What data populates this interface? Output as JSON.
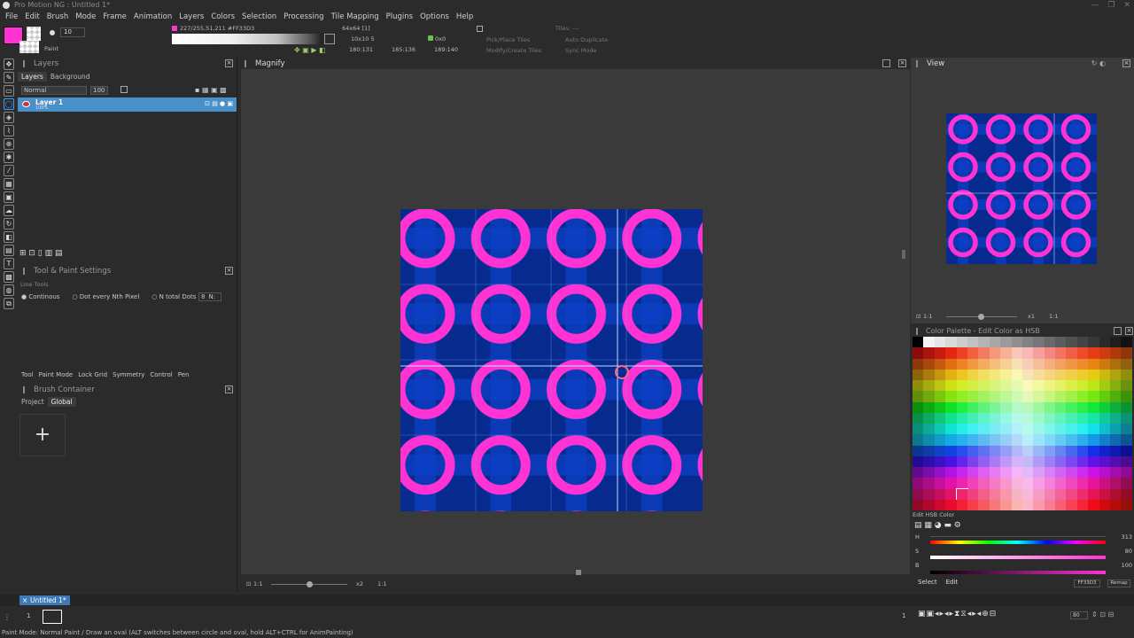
{
  "window": {
    "title": "Pro Motion NG : Untitled 1*",
    "controls": [
      "—",
      "❐",
      "✕"
    ]
  },
  "menu": [
    "File",
    "Edit",
    "Brush",
    "Mode",
    "Frame",
    "Animation",
    "Layers",
    "Colors",
    "Selection",
    "Processing",
    "Tile Mapping",
    "Plugins",
    "Options",
    "Help"
  ],
  "toolbar": {
    "brush_size": "10",
    "mode_label": "Paint",
    "color_readout": "227/255,51,211 #FF33D3",
    "image_size": "64x64 [1]",
    "grid_size": "10x10 5",
    "offset": "0x0",
    "coord_a": "180:131",
    "coord_b": "185:136",
    "coord_c": "189:140",
    "tiles_label": "Tiles: ---",
    "pick_place": "Pick/Place Tiles",
    "modify_create": "Modify/Create Tiles",
    "auto_duplicate": "Auto Duplicate",
    "sync_mode": "Sync Mode",
    "accent_color": "#FF33D3"
  },
  "layers_panel": {
    "title": "Layers",
    "tabs": [
      "Layers",
      "Background"
    ],
    "blend_mode": "Normal",
    "opacity": "100",
    "layer_name": "Layer 1",
    "layer_opacity": "100%"
  },
  "tool_settings": {
    "title": "Tool & Paint Settings",
    "section": "Line Tools",
    "options": [
      "Continous",
      "Dot every Nth Pixel",
      "N total Dots"
    ],
    "n_label": "N:",
    "n_value": "8",
    "tabs": [
      "Tool",
      "Paint Mode",
      "Lock Grid",
      "Symmetry",
      "Control",
      "Pen"
    ]
  },
  "brush_container": {
    "title": "Brush Container",
    "tabs": [
      "Project",
      "Global"
    ],
    "add": "+"
  },
  "magnify": {
    "title": "Magnify",
    "zoom_left": "1:1",
    "zoom_mid": "x2",
    "zoom_right": "1:1"
  },
  "view_panel": {
    "title": "View",
    "zoom_left": "1:1",
    "zoom_mid": "x1",
    "zoom_right": "1:1"
  },
  "palette_panel": {
    "title": "Color Palette - Edit Color as HSB",
    "edit_label": "Edit HSB Color",
    "h_label": "H",
    "h_value": "313",
    "s_label": "S",
    "s_value": "80",
    "b_label": "B",
    "b_value": "100",
    "select": "Select",
    "edit": "Edit",
    "hex": "FF33D3",
    "remap": "Remap"
  },
  "document_tab": "Untitled 1*",
  "frame_bar": {
    "frame_number": "1",
    "right_num": "1",
    "fps": "80"
  },
  "status": "Paint Mode: Normal Paint / Draw an oval (ALT switches between circle and oval, hold ALT+CTRL for AnimPainting)"
}
